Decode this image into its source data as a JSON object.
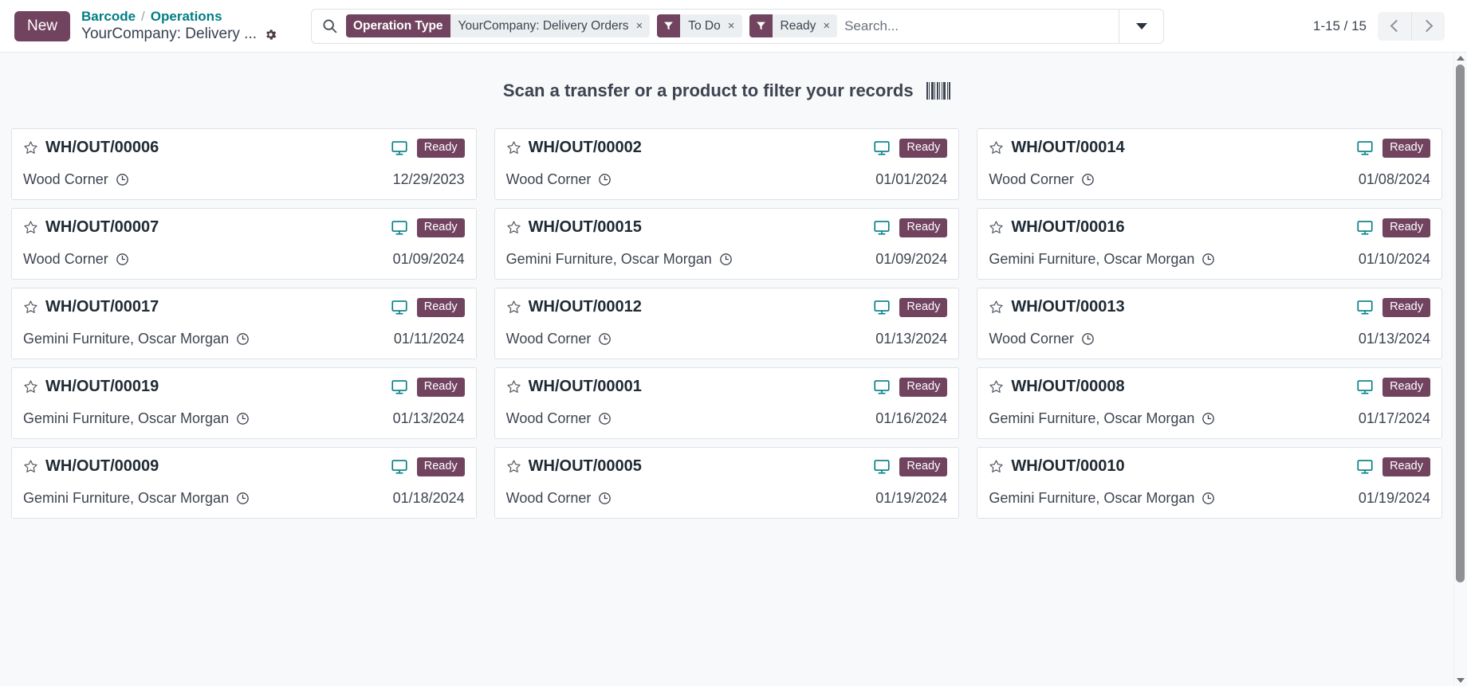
{
  "topbar": {
    "new_label": "New",
    "breadcrumb": {
      "root": "Barcode",
      "separator": "/",
      "section": "Operations"
    },
    "subtitle": "YourCompany: Delivery ...",
    "settings_icon": "gear-icon"
  },
  "search": {
    "icon": "search-icon",
    "placeholder": "Search...",
    "value": "",
    "toggle_icon": "chevron-down-icon",
    "facets": [
      {
        "key": "Operation Type",
        "key_type": "text",
        "value": "YourCompany: Delivery Orders",
        "remove": "×"
      },
      {
        "key": "filter-icon",
        "key_type": "icon",
        "value": "To Do",
        "remove": "×"
      },
      {
        "key": "filter-icon",
        "key_type": "icon",
        "value": "Ready",
        "remove": "×"
      }
    ]
  },
  "pager": {
    "count": "1-15 / 15",
    "prev_icon": "chevron-left-icon",
    "next_icon": "chevron-right-icon"
  },
  "banner": {
    "text": "Scan a transfer or a product to filter your records",
    "icon": "barcode-icon"
  },
  "colors": {
    "accent_purple": "#71435f",
    "link_teal": "#017e84",
    "badge_bg": "#71435f",
    "page_bg": "#f8f9fa",
    "card_border": "#dfe2e6"
  },
  "records": [
    {
      "name": "WH/OUT/00006",
      "partner": "Wood Corner",
      "date": "12/29/2023",
      "state": "Ready"
    },
    {
      "name": "WH/OUT/00002",
      "partner": "Wood Corner",
      "date": "01/01/2024",
      "state": "Ready"
    },
    {
      "name": "WH/OUT/00014",
      "partner": "Wood Corner",
      "date": "01/08/2024",
      "state": "Ready"
    },
    {
      "name": "WH/OUT/00007",
      "partner": "Wood Corner",
      "date": "01/09/2024",
      "state": "Ready"
    },
    {
      "name": "WH/OUT/00015",
      "partner": "Gemini Furniture, Oscar Morgan",
      "date": "01/09/2024",
      "state": "Ready"
    },
    {
      "name": "WH/OUT/00016",
      "partner": "Gemini Furniture, Oscar Morgan",
      "date": "01/10/2024",
      "state": "Ready"
    },
    {
      "name": "WH/OUT/00017",
      "partner": "Gemini Furniture, Oscar Morgan",
      "date": "01/11/2024",
      "state": "Ready"
    },
    {
      "name": "WH/OUT/00012",
      "partner": "Wood Corner",
      "date": "01/13/2024",
      "state": "Ready"
    },
    {
      "name": "WH/OUT/00013",
      "partner": "Wood Corner",
      "date": "01/13/2024",
      "state": "Ready"
    },
    {
      "name": "WH/OUT/00019",
      "partner": "Gemini Furniture, Oscar Morgan",
      "date": "01/13/2024",
      "state": "Ready"
    },
    {
      "name": "WH/OUT/00001",
      "partner": "Wood Corner",
      "date": "01/16/2024",
      "state": "Ready"
    },
    {
      "name": "WH/OUT/00008",
      "partner": "Gemini Furniture, Oscar Morgan",
      "date": "01/17/2024",
      "state": "Ready"
    },
    {
      "name": "WH/OUT/00009",
      "partner": "Gemini Furniture, Oscar Morgan",
      "date": "01/18/2024",
      "state": "Ready"
    },
    {
      "name": "WH/OUT/00005",
      "partner": "Wood Corner",
      "date": "01/19/2024",
      "state": "Ready"
    },
    {
      "name": "WH/OUT/00010",
      "partner": "Gemini Furniture, Oscar Morgan",
      "date": "01/19/2024",
      "state": "Ready"
    }
  ],
  "card_icons": {
    "favorite": "star-outline-icon",
    "device": "monitor-icon",
    "schedule": "clock-icon"
  },
  "scrollbar": {
    "up_icon": "scroll-up-arrow-icon",
    "down_icon": "scroll-down-arrow-icon"
  }
}
